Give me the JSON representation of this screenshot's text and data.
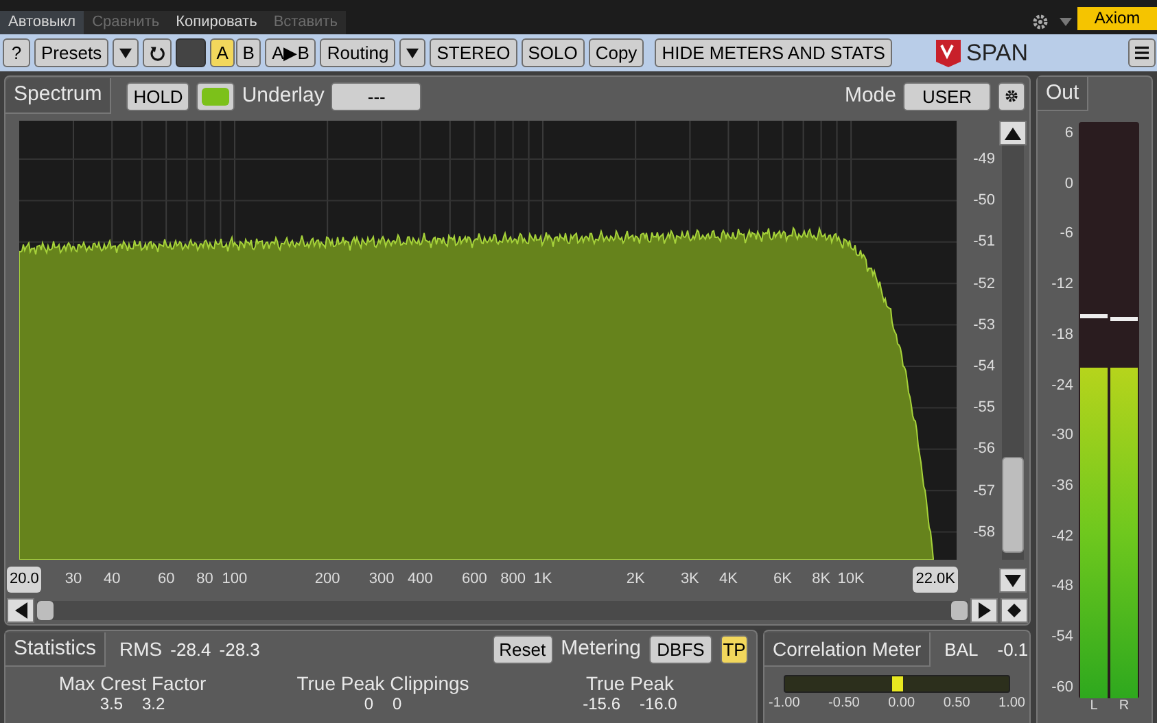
{
  "host_bar": {
    "buttons": [
      {
        "label": "Автовыкл",
        "disabled": false
      },
      {
        "label": "Сравнить",
        "disabled": true
      },
      {
        "label": "Копировать",
        "disabled": false
      },
      {
        "label": "Вставить",
        "disabled": true
      }
    ],
    "preset": "Axiom"
  },
  "toolbar": {
    "help": "?",
    "presets": "Presets",
    "ab": [
      {
        "label": "A",
        "selected": true
      },
      {
        "label": "B",
        "selected": false
      }
    ],
    "a_to_b": "A▶B",
    "routing": "Routing",
    "buttons": [
      "STEREO",
      "SOLO",
      "Copy",
      "HIDE METERS AND STATS"
    ],
    "logo": "SPAN"
  },
  "spectrum": {
    "tab": "Spectrum",
    "hold": "HOLD",
    "hold_color_on": true,
    "underlay_label": "Underlay",
    "underlay_value": "---",
    "mode_label": "Mode",
    "mode_value": "USER",
    "y_labels": [
      "-49",
      "-50",
      "-51",
      "-52",
      "-53",
      "-54",
      "-55",
      "-56",
      "-57",
      "-58"
    ],
    "x_labels": [
      "30",
      "40",
      "60",
      "80",
      "100",
      "200",
      "300",
      "400",
      "600",
      "800",
      "1K",
      "2K",
      "3K",
      "4K",
      "6K",
      "8K",
      "10K"
    ],
    "x_min": "20.0",
    "x_max": "22.0K"
  },
  "statistics": {
    "tab": "Statistics",
    "rms_label": "RMS",
    "rms_values": [
      "-28.4",
      "-28.3"
    ],
    "reset": "Reset",
    "metering_label": "Metering",
    "metering_value": "DBFS",
    "tp": {
      "label": "TP",
      "on": true
    },
    "stats": [
      {
        "label": "Max Crest Factor",
        "values": [
          "3.5",
          "3.2"
        ]
      },
      {
        "label": "True Peak Clippings",
        "values": [
          "0",
          "0"
        ]
      },
      {
        "label": "True Peak",
        "values": [
          "-15.6",
          "-16.0"
        ]
      }
    ]
  },
  "correlation": {
    "title": "Correlation Meter",
    "bal_label": "BAL",
    "bal_value": "-0.1",
    "level": 0.5,
    "ticks": [
      "-1.00",
      "-0.50",
      "0.00",
      "0.50",
      "1.00"
    ]
  },
  "out": {
    "tab": "Out",
    "scale": [
      "6",
      "0",
      "-6",
      "-12",
      "-18",
      "-24",
      "-30",
      "-36",
      "-42",
      "-48",
      "-54",
      "-60"
    ],
    "channels": [
      {
        "label": "L",
        "level": 0.573,
        "peak_hold": {
          "level": 0.66
        }
      },
      {
        "label": "R",
        "level": 0.573,
        "peak_hold": {
          "level": 0.655
        }
      }
    ]
  }
}
